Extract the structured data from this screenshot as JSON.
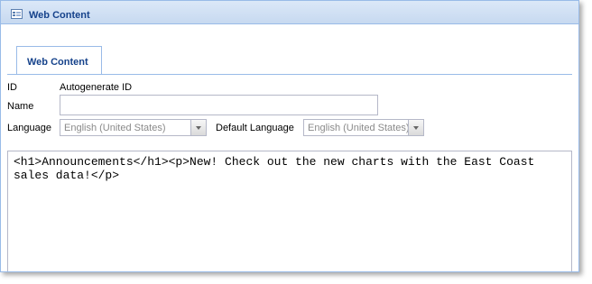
{
  "window": {
    "title": "Web Content"
  },
  "tabs": [
    {
      "label": "Web Content"
    }
  ],
  "form": {
    "id_label": "ID",
    "id_value": "Autogenerate ID",
    "name_label": "Name",
    "name_value": "",
    "language_label": "Language",
    "language_value": "English (United States)",
    "default_language_label": "Default Language",
    "default_language_value": "English (United States)"
  },
  "editor": {
    "content": "<h1>Announcements</h1><p>New! Check out the new charts with the East Coast sales data!</p>"
  },
  "colors": {
    "title_text": "#15428b",
    "border": "#99bbe8",
    "field_border": "#b5b8c8"
  }
}
